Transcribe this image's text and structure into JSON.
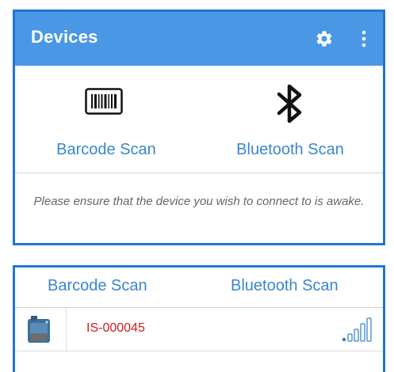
{
  "appbar": {
    "title": "Devices",
    "settings_icon": "gear-icon",
    "menu_icon": "more-vert-icon"
  },
  "scan_options": {
    "barcode": {
      "label": "Barcode Scan",
      "icon": "barcode-icon"
    },
    "bluetooth": {
      "label": "Bluetooth Scan",
      "icon": "bluetooth-icon"
    }
  },
  "notice": "Please ensure that the device you wish to connect to is awake.",
  "tabs": {
    "barcode": "Barcode Scan",
    "bluetooth": "Bluetooth Scan"
  },
  "devices": [
    {
      "name": "IS-000045",
      "icon": "device-icon",
      "signal_icon": "signal-strength-icon"
    }
  ],
  "colors": {
    "appbar": "#4a97e6",
    "accent_text": "#3a86cf",
    "device_name": "#d0191e",
    "panel_border": "#1f77d2"
  }
}
